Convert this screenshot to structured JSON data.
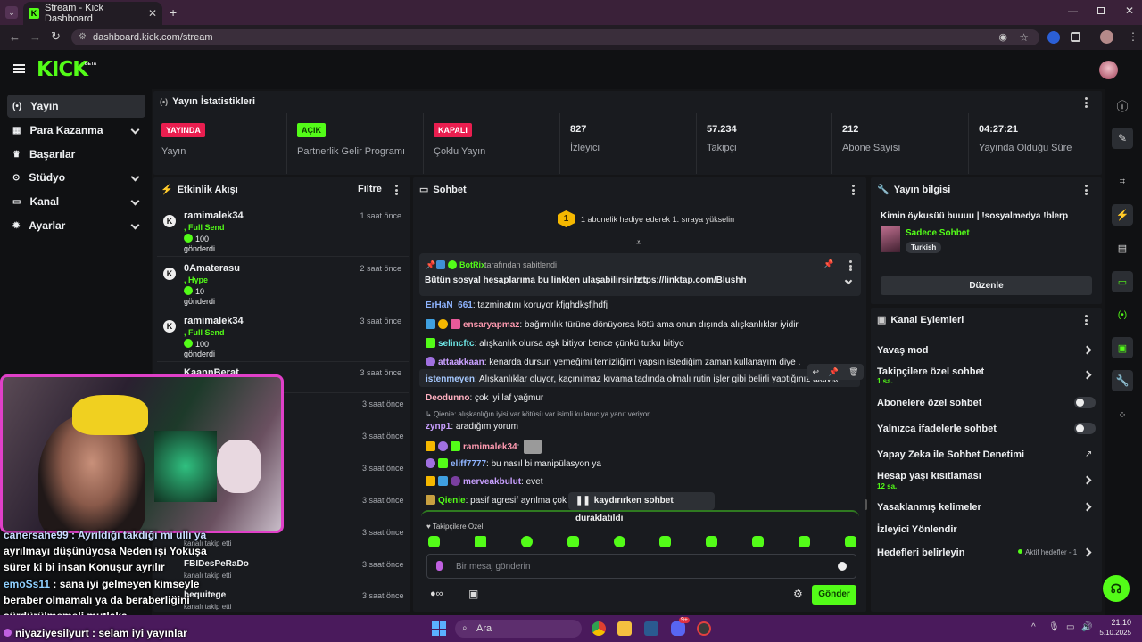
{
  "browser": {
    "tab_title": "Stream - Kick Dashboard",
    "url": "dashboard.kick.com/stream"
  },
  "kick": {
    "logo": "KICK",
    "beta": "BETA"
  },
  "sidebar": {
    "items": [
      {
        "label": "Yayın",
        "icon": "broadcast-icon"
      },
      {
        "label": "Para Kazanma",
        "icon": "money-icon"
      },
      {
        "label": "Başarılar",
        "icon": "trophy-icon"
      },
      {
        "label": "Stüdyo",
        "icon": "studio-icon"
      },
      {
        "label": "Kanal",
        "icon": "channel-icon"
      },
      {
        "label": "Ayarlar",
        "icon": "gear-icon"
      }
    ]
  },
  "stats": {
    "title": "Yayın İstatistikleri",
    "cards": [
      {
        "badge": "YAYINDA",
        "label": "Yayın",
        "color": "#e91e4f"
      },
      {
        "badge": "AÇIK",
        "label": "Partnerlik Gelir Programı",
        "color": "#53fc18"
      },
      {
        "badge": "KAPALI",
        "label": "Çoklu Yayın",
        "color": "#e91e4f"
      },
      {
        "value": "827",
        "label": "İzleyici"
      },
      {
        "value": "57.234",
        "label": "Takipçi"
      },
      {
        "value": "212",
        "label": "Abone Sayısı"
      },
      {
        "value": "04:27:21",
        "label": "Yayında Olduğu Süre"
      }
    ]
  },
  "activity": {
    "title": "Etkinlik Akışı",
    "filter": "Filtre",
    "rows": [
      {
        "user": "ramimalek34",
        "type": ", Full Send",
        "amount": "100",
        "action": "gönderdi",
        "time": "1 saat önce"
      },
      {
        "user": "0Amaterasu",
        "type": ", Hype",
        "amount": "10",
        "action": "gönderdi",
        "time": "2 saat önce"
      },
      {
        "user": "ramimalek34",
        "type": ", Full Send",
        "amount": "100",
        "action": "gönderdi",
        "time": "3 saat önce"
      },
      {
        "user": "KaannBerat",
        "time": "3 saat önce"
      },
      {
        "user": "",
        "time": "3 saat önce"
      },
      {
        "user": "",
        "time": "3 saat önce"
      },
      {
        "user": "",
        "time": "3 saat önce"
      },
      {
        "user": "",
        "time": "3 saat önce"
      },
      {
        "user": "",
        "action": "kanalı takip etti",
        "time": "3 saat önce"
      },
      {
        "user": "FBIDesPeRaDo",
        "action": "kanalı takip etti",
        "time": "3 saat önce"
      },
      {
        "user": "bequitege",
        "action": "kanalı takip etti",
        "time": "3 saat önce"
      }
    ]
  },
  "chat": {
    "title": "Sohbet",
    "sub_goal_count": "1",
    "sub_goal_text": "1 abonelik hediye ederek 1. sıraya yükselin",
    "pinned_by": "BotRix",
    "pinned_suffix": "tarafından sabitlendi",
    "pinned_text": "Bütün sosyal hesaplarıma bu linkten ulaşabilirsiniz :",
    "pinned_link": "https://linktap.com/Blushh",
    "messages": [
      {
        "user": "ErHaN_661",
        "color": "#8fb4ff",
        "text": ": tazminatını koruyor kfjghdkşfjhdfj"
      },
      {
        "user": "ensaryapmaz",
        "color": "#ff9ab0",
        "text": ": bağımlılık türüne dönüyorsa kötü ama onun dışında alışkanlıklar iyidir"
      },
      {
        "user": "selincftc",
        "color": "#6ee7e7",
        "text": ": alışkanlık olursa aşk bitiyor bence çünkü tutku bitiyo"
      },
      {
        "user": "attaakkaan",
        "color": "#c9a0ff",
        "text": ": kenarda dursun yemeğimi temizliğimi yapsın istediğim zaman kullanayım diye ."
      },
      {
        "user": "istenmeyen",
        "color": "#a5c8ff",
        "text": ": Alışkanlıklar oluyor, kaçınılmaz kıvama tadında olmalı rutin işler gibi belirli yaptığınız aktiviteler ve gibi"
      },
      {
        "user": "Deodunno",
        "color": "#ffb0c0",
        "text": ": çok iyi laf yağmur"
      },
      {
        "reply": "Qienie: alışkanlığın iyisi var kötüsü var isimli kullanıcıya yanıt veriyor"
      },
      {
        "user": "zynp1",
        "color": "#c9a0ff",
        "text": ": aradığım yorum"
      },
      {
        "user": "ramimalek34",
        "color": "#ff9ab0",
        "text": ":"
      },
      {
        "user": "eliff7777",
        "color": "#8fb4ff",
        "text": ": bu nasıl bi manipülasyon ya"
      },
      {
        "user": "merveakbulut",
        "color": "#c9a0ff",
        "text": ": evet"
      },
      {
        "user": "Qienie",
        "color": "#53fc18",
        "text": ": pasif agresif ayrılma çok yo"
      }
    ],
    "paused": "kaydırırken sohbet duraklatıldı",
    "emote_label": "Takipçilere Özel",
    "input_placeholder": "Bir mesaj gönderin",
    "send": "Gönder"
  },
  "stream_info": {
    "title": "Yayın bilgisi",
    "stream_title": "Kimin öykusüü buuuu | !sosyalmedya !blerp",
    "category": "Sadece Sohbet",
    "tag": "Turkish",
    "edit": "Düzenle"
  },
  "channel_actions": {
    "title": "Kanal Eylemleri",
    "items": [
      {
        "label": "Yavaş mod",
        "kind": "arrow"
      },
      {
        "label": "Takipçilere özel sohbet",
        "sub": "1 sa.",
        "kind": "arrow"
      },
      {
        "label": "Abonelere özel sohbet",
        "kind": "toggle"
      },
      {
        "label": "Yalnızca ifadelerle sohbet",
        "kind": "toggle"
      },
      {
        "label": "Yapay Zeka ile Sohbet Denetimi",
        "kind": "external"
      },
      {
        "label": "Hesap yaşı kısıtlaması",
        "sub": "12 sa.",
        "kind": "arrow"
      },
      {
        "label": "Yasaklanmış kelimeler",
        "kind": "arrow"
      },
      {
        "label": "İzleyici Yönlendir",
        "kind": "none"
      },
      {
        "label": "Hedefleri belirleyin",
        "status": "Aktif hedefler - 1",
        "kind": "arrow"
      }
    ]
  },
  "overlay_chat": [
    {
      "text": "canersahe99 : Ayrıldığı takdiği mi ullı ya"
    },
    {
      "text": "ayrılmayı düşünüyosa Neden işi Yokuşa"
    },
    {
      "text": "sürer ki bi insan Konuşur ayrılır"
    },
    {
      "user": "emoSs11",
      "text": " : sana iyi gelmeyen kimseyle"
    },
    {
      "text": "beraber olmamalı ya da beraberliğini"
    },
    {
      "text": "sürdürülmemeli mutlaka"
    },
    {
      "user": "niyaziyesilyurt",
      "text": " : selam iyi yayınlar"
    }
  ],
  "taskbar": {
    "search": "Ara",
    "time": "21:10",
    "date": "5.10.2025",
    "discord_badge": "9+"
  }
}
